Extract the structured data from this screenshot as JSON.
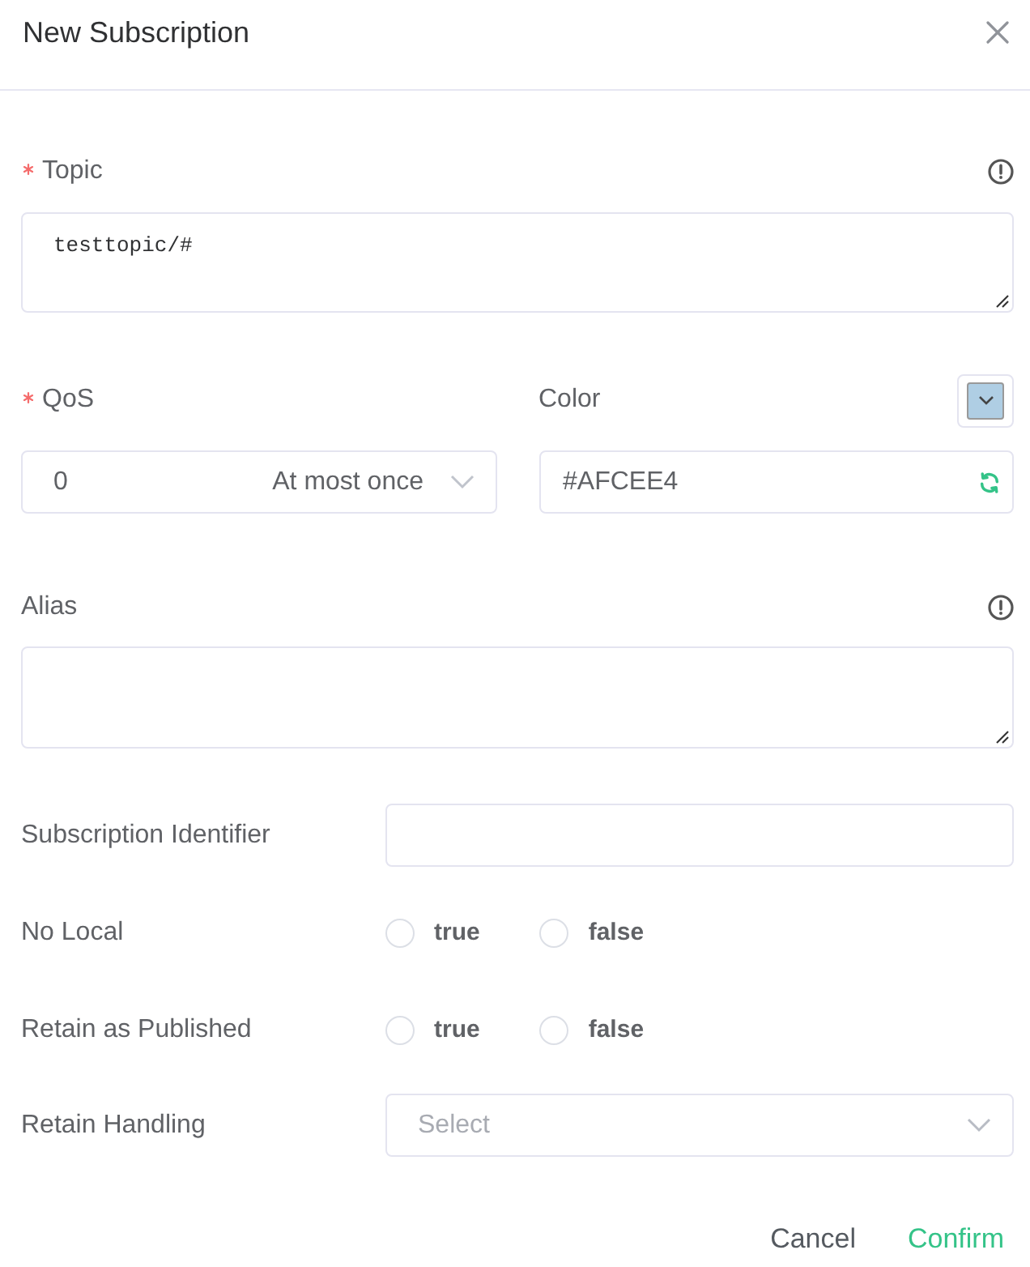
{
  "dialog": {
    "title": "New Subscription"
  },
  "topic": {
    "label": "Topic",
    "required": true,
    "value": "testtopic/#"
  },
  "qos": {
    "label": "QoS",
    "required": true,
    "value": "0",
    "description": "At most once"
  },
  "color": {
    "label": "Color",
    "required": false,
    "value": "#AFCEE4"
  },
  "alias": {
    "label": "Alias",
    "required": false
  },
  "advanced": [
    {
      "kind": "input",
      "label": "Subscription Identifier"
    },
    {
      "kind": "radio",
      "label": "No Local",
      "choices": [
        {
          "label": "true",
          "selected": false
        },
        {
          "label": "false",
          "selected": false
        }
      ]
    },
    {
      "kind": "radio",
      "label": "Retain as Published",
      "choices": [
        {
          "label": "true",
          "selected": false
        },
        {
          "label": "false",
          "selected": false
        }
      ]
    },
    {
      "kind": "select",
      "label": "Retain Handling",
      "placeholder": "Select"
    }
  ],
  "buttons": [
    {
      "label": "Cancel",
      "kind": "default"
    },
    {
      "label": "Confirm",
      "kind": "primary"
    }
  ]
}
